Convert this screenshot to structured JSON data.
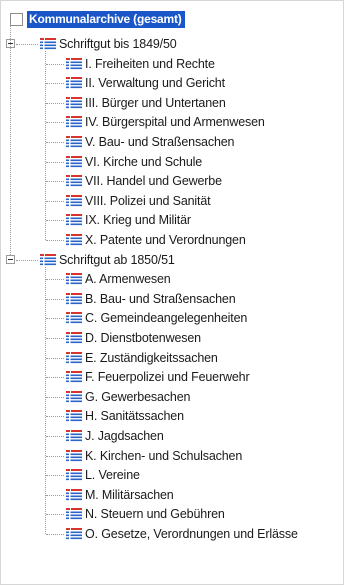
{
  "tree": {
    "root": {
      "label": "Kommunalarchive (gesamt)",
      "checked": false,
      "highlight_color": "#1a56c8"
    },
    "groups": [
      {
        "label": "Schriftgut bis 1849/50",
        "expanded": true,
        "icon": "list-table-icon",
        "children": [
          "I. Freiheiten und Rechte",
          "II. Verwaltung und Gericht",
          "III. Bürger und Untertanen",
          "IV. Bürgerspital und Armenwesen",
          "V. Bau- und Straßensachen",
          "VI. Kirche und Schule",
          "VII. Handel und Gewerbe",
          "VIII. Polizei und Sanität",
          "IX. Krieg und Militär",
          "X. Patente und Verordnungen"
        ]
      },
      {
        "label": "Schriftgut ab 1850/51",
        "expanded": true,
        "icon": "list-table-icon",
        "children": [
          "A. Armenwesen",
          "B. Bau- und Straßensachen",
          "C. Gemeindeangelegenheiten",
          "D. Dienstbotenwesen",
          "E. Zuständigkeitssachen",
          "F. Feuerpolizei und Feuerwehr",
          "G. Gewerbesachen",
          "H. Sanitätssachen",
          "J. Jagdsachen",
          "K. Kirchen- und Schulsachen",
          "L. Vereine",
          "M. Militärsachen",
          "N. Steuern und Gebühren",
          "O. Gesetze, Verordnungen und Erlässe"
        ]
      }
    ]
  },
  "colors": {
    "icon_red": "#d9342b",
    "icon_blue": "#2a63c9",
    "tree_line": "#9c9c9c"
  }
}
